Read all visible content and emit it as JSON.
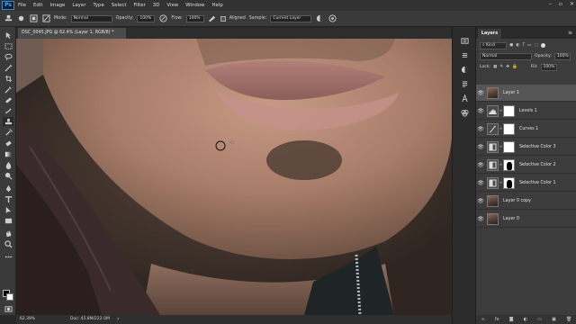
{
  "app": {
    "logo": "Ps"
  },
  "menu": [
    "File",
    "Edit",
    "Image",
    "Layer",
    "Type",
    "Select",
    "Filter",
    "3D",
    "View",
    "Window",
    "Help"
  ],
  "window_controls": [
    "–",
    "▫",
    "✕"
  ],
  "options": {
    "mode_label": "Mode:",
    "mode_value": "Normal",
    "opacity_label": "Opacity:",
    "opacity_value": "100%",
    "flow_label": "Flow:",
    "flow_value": "100%",
    "aligned_label": "Aligned",
    "sample_label": "Sample:",
    "sample_value": "Current Layer"
  },
  "document": {
    "tab_title": "DSC_0045.JPG @ 62.4% (Layer 1, RGB/8) *"
  },
  "status": {
    "zoom": "62.39%",
    "doc": "Doc: 45.8M/222.0M"
  },
  "layers_panel": {
    "tab": "Layers",
    "filter_label": "Kind",
    "blend_mode": "Normal",
    "opacity_label": "Opacity:",
    "opacity_value": "100%",
    "lock_label": "Lock:",
    "fill_label": "Fill:",
    "fill_value": "100%",
    "layers": [
      {
        "name": "Layer 1",
        "thumb": "photo",
        "selected": true
      },
      {
        "name": "Levels 1",
        "thumb": "levels",
        "mask": "white"
      },
      {
        "name": "Curves 1",
        "thumb": "curves",
        "mask": "white"
      },
      {
        "name": "Selective Color 3",
        "thumb": "selcolor",
        "mask": "white"
      },
      {
        "name": "Selective Color 2",
        "thumb": "selcolor",
        "mask": "shape"
      },
      {
        "name": "Selective Color 1",
        "thumb": "selcolor",
        "mask": "shape"
      },
      {
        "name": "Layer 0 copy",
        "thumb": "photo"
      },
      {
        "name": "Layer 0",
        "thumb": "photo"
      }
    ]
  },
  "colors": {
    "ui_dark": "#282828",
    "panel": "#3c3c3c",
    "ps_blue": "#2e8fd6",
    "selected_layer": "#565656"
  },
  "icons": [
    "move-icon",
    "marquee-icon",
    "lasso-icon",
    "magic-wand-icon",
    "crop-icon",
    "eyedropper-icon",
    "healing-brush-icon",
    "brush-icon",
    "clone-stamp-icon",
    "history-brush-icon",
    "eraser-icon",
    "gradient-icon",
    "blur-icon",
    "dodge-icon",
    "pen-icon",
    "type-icon",
    "path-select-icon",
    "shape-icon",
    "hand-icon",
    "zoom-icon",
    "eye-icon",
    "link-icon"
  ]
}
